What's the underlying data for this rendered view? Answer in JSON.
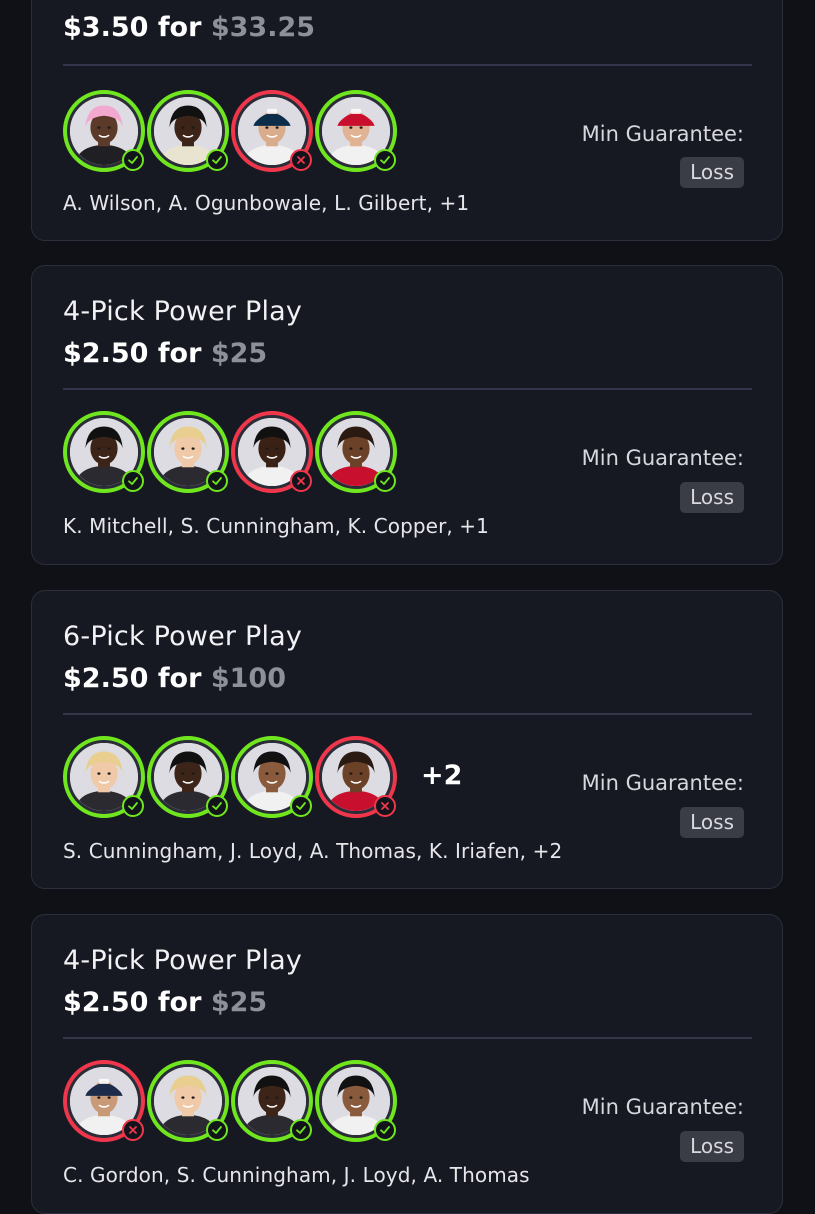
{
  "cards": [
    {
      "title": "",
      "stake": "$3.50",
      "for_word": "for",
      "payout": "$33.25",
      "avatars": [
        {
          "result": "win",
          "skin": "#5b3a2a",
          "hair": "#f3a9cf",
          "jersey": "#1f1f24"
        },
        {
          "result": "win",
          "skin": "#3d2418",
          "hair": "#111111",
          "jersey": "#e8e4cf"
        },
        {
          "result": "loss",
          "skin": "#d9ad8c",
          "hair": "#1b1b1b",
          "jersey": "#f1f1f1",
          "cap": "#0b2d4a"
        },
        {
          "result": "win",
          "skin": "#e0b394",
          "hair": "#3a2a1e",
          "jersey": "#f1f1f1",
          "cap": "#c8102e"
        }
      ],
      "more": "",
      "names": "A. Wilson, A. Ogunbowale, L. Gilbert, +1",
      "guarantee_label": "Min Guarantee:",
      "guarantee_value": "Loss"
    },
    {
      "title": "4-Pick Power Play",
      "stake": "$2.50",
      "for_word": "for",
      "payout": "$25",
      "avatars": [
        {
          "result": "win",
          "skin": "#3d2418",
          "hair": "#111111",
          "jersey": "#2a2a30"
        },
        {
          "result": "win",
          "skin": "#f0c9a8",
          "hair": "#e8cf8f",
          "jersey": "#2a2a30"
        },
        {
          "result": "loss",
          "skin": "#3a2116",
          "hair": "#111111",
          "jersey": "#f1f1f1"
        },
        {
          "result": "win",
          "skin": "#6b4128",
          "hair": "#2a1a12",
          "jersey": "#c8102e"
        }
      ],
      "more": "",
      "names": "K. Mitchell, S. Cunningham, K. Copper, +1",
      "guarantee_label": "Min Guarantee:",
      "guarantee_value": "Loss"
    },
    {
      "title": "6-Pick Power Play",
      "stake": "$2.50",
      "for_word": "for",
      "payout": "$100",
      "avatars": [
        {
          "result": "win",
          "skin": "#f0c9a8",
          "hair": "#e8cf8f",
          "jersey": "#2a2a30"
        },
        {
          "result": "win",
          "skin": "#3d2418",
          "hair": "#111111",
          "jersey": "#2a2a30"
        },
        {
          "result": "win",
          "skin": "#8a5a3c",
          "hair": "#111111",
          "jersey": "#f1f1f1"
        },
        {
          "result": "loss",
          "skin": "#6b4128",
          "hair": "#2a1a12",
          "jersey": "#c8102e"
        }
      ],
      "more": "+2",
      "names": "S. Cunningham, J. Loyd, A. Thomas, K. Iriafen, +2",
      "guarantee_label": "Min Guarantee:",
      "guarantee_value": "Loss"
    },
    {
      "title": "4-Pick Power Play",
      "stake": "$2.50",
      "for_word": "for",
      "payout": "$25",
      "avatars": [
        {
          "result": "loss",
          "skin": "#c99a78",
          "hair": "#1b1b1b",
          "jersey": "#f1f1f1",
          "cap": "#1d2b4a"
        },
        {
          "result": "win",
          "skin": "#f0c9a8",
          "hair": "#e8cf8f",
          "jersey": "#2a2a30"
        },
        {
          "result": "win",
          "skin": "#3d2418",
          "hair": "#111111",
          "jersey": "#2a2a30"
        },
        {
          "result": "win",
          "skin": "#8a5a3c",
          "hair": "#111111",
          "jersey": "#f1f1f1"
        }
      ],
      "more": "",
      "names": "C. Gordon, S. Cunningham, J. Loyd, A. Thomas",
      "guarantee_label": "Min Guarantee:",
      "guarantee_value": "Loss"
    }
  ],
  "colors": {
    "win": "#6fe61e",
    "loss": "#f0364a",
    "card_bg": "#171922",
    "page_bg": "#0f1117"
  },
  "icons": {
    "win": "check-icon",
    "loss": "x-icon"
  }
}
